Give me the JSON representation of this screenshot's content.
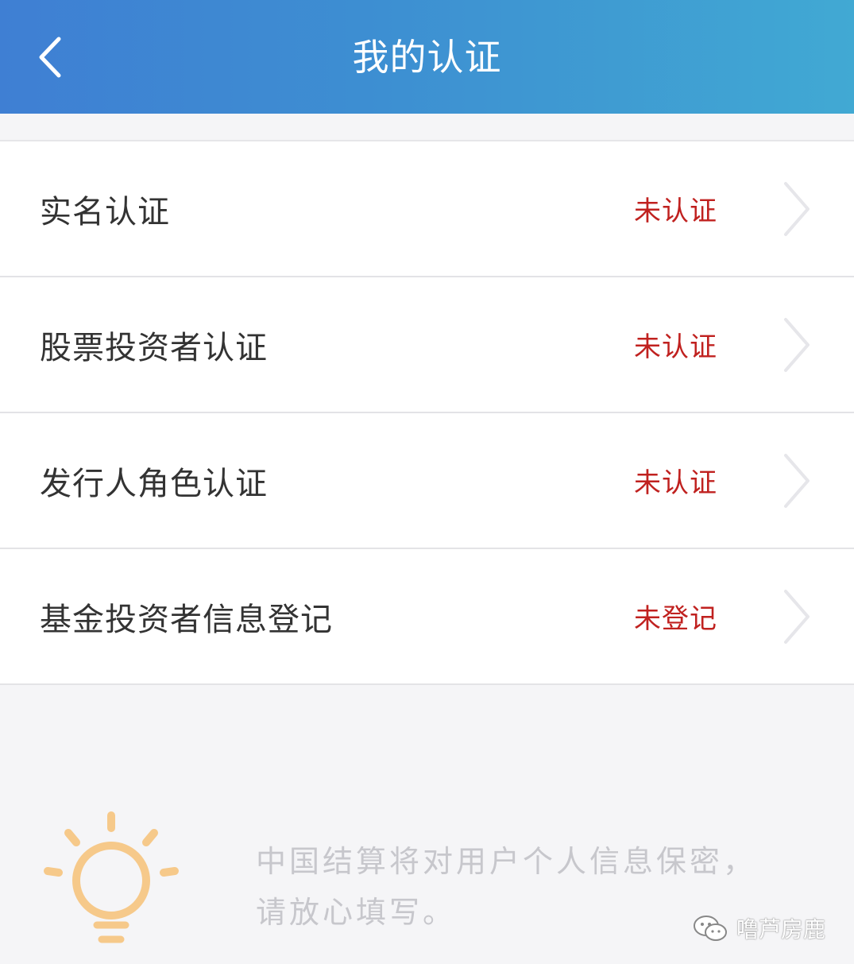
{
  "header": {
    "title": "我的认证",
    "back_icon": "chevron-left-icon",
    "gradient": [
      "#3f7fd3",
      "#41a9d3"
    ]
  },
  "list": {
    "items": [
      {
        "label": "实名认证",
        "status": "未认证"
      },
      {
        "label": "股票投资者认证",
        "status": "未认证"
      },
      {
        "label": "发行人角色认证",
        "status": "未认证"
      },
      {
        "label": "基金投资者信息登记",
        "status": "未登记"
      }
    ],
    "status_color": "#c0211f",
    "chevron_icon": "chevron-right-icon"
  },
  "notice": {
    "icon": "lightbulb-icon",
    "icon_color": "#f6c98a",
    "line1": "中国结算将对用户个人信息保密，",
    "line2": "请放心填写。"
  },
  "watermark": {
    "icon": "wechat-icon",
    "text": "噜芦房鹿"
  }
}
